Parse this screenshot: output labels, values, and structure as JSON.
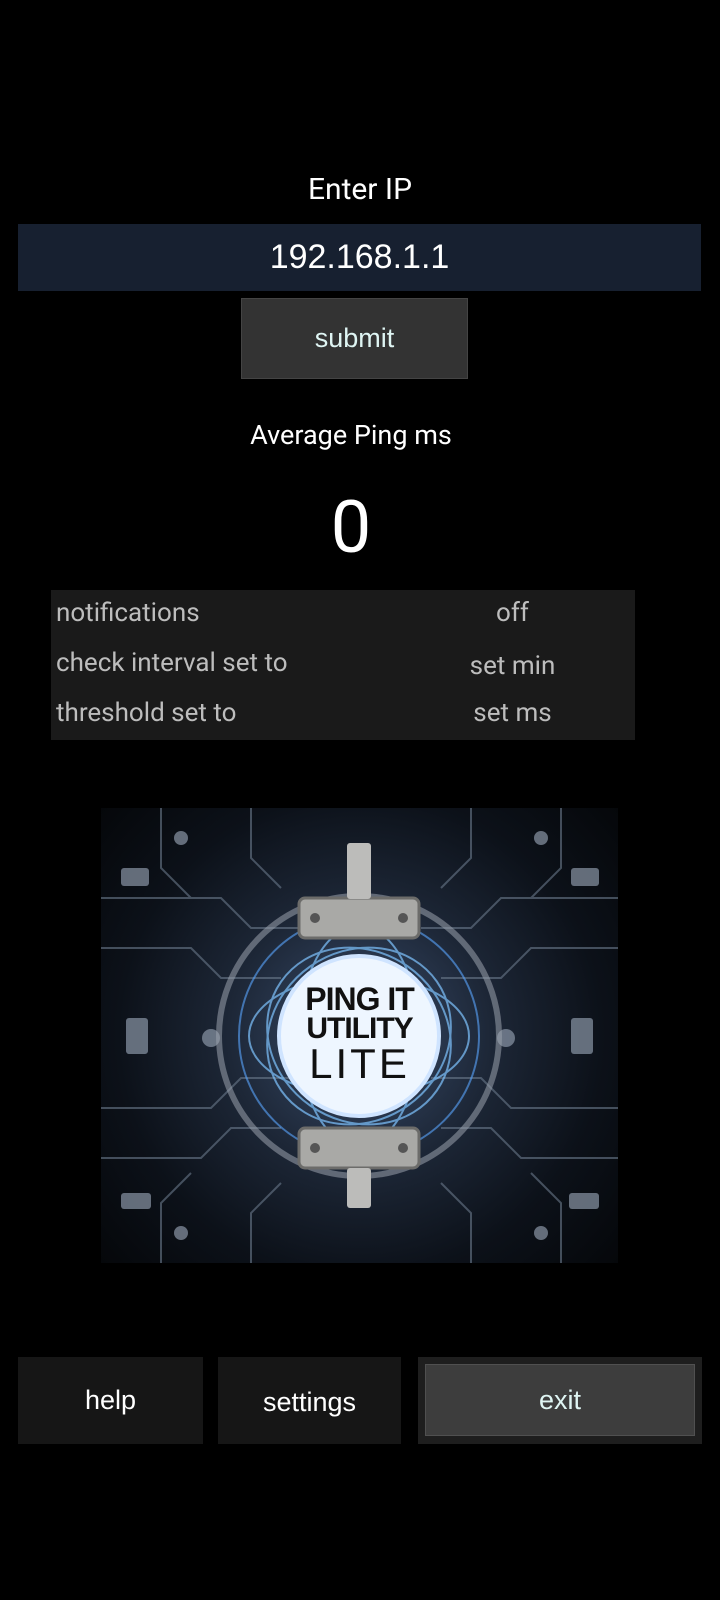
{
  "form": {
    "enter_label": "Enter IP",
    "ip_value": "192.168.1.1",
    "submit_label": "submit"
  },
  "stats": {
    "avg_label": "Average Ping ms",
    "avg_value": "0"
  },
  "settings_rows": [
    {
      "label": "notifications",
      "value": "off"
    },
    {
      "label": "check interval set to",
      "value": "set min"
    },
    {
      "label": "threshold set to",
      "value": "set ms"
    }
  ],
  "logo": {
    "line1": "PING IT",
    "line2": "UTILITY",
    "line3": "LITE"
  },
  "bottom_nav": {
    "help_label": "help",
    "settings_label": "settings",
    "exit_label": "exit"
  },
  "colors": {
    "background": "#000000",
    "input_bg": "#172030",
    "button_bg": "#333333",
    "button_text": "#dff5f3",
    "table_bg": "#1a1a1a",
    "table_text": "#bdbdbd"
  }
}
